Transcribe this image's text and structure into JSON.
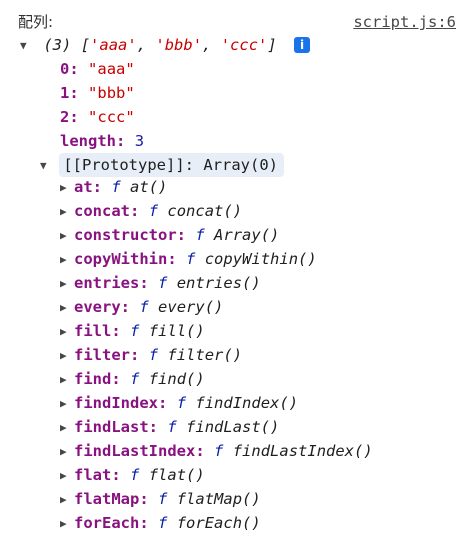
{
  "header": {
    "label": "配列:",
    "source_link": "script.js:6"
  },
  "array": {
    "summary_count": "(3)",
    "summary_open": "[",
    "summary_items": [
      "'aaa'",
      "'bbb'",
      "'ccc'"
    ],
    "summary_close": "]",
    "info_badge": "i",
    "entries": [
      {
        "key": "0",
        "value": "\"aaa\""
      },
      {
        "key": "1",
        "value": "\"bbb\""
      },
      {
        "key": "2",
        "value": "\"ccc\""
      }
    ],
    "length_key": "length",
    "length_value": "3"
  },
  "prototype": {
    "label": "[[Prototype]]",
    "value": "Array(0)",
    "methods": [
      {
        "name": "at",
        "signature": "at()"
      },
      {
        "name": "concat",
        "signature": "concat()"
      },
      {
        "name": "constructor",
        "signature": "Array()"
      },
      {
        "name": "copyWithin",
        "signature": "copyWithin()"
      },
      {
        "name": "entries",
        "signature": "entries()"
      },
      {
        "name": "every",
        "signature": "every()"
      },
      {
        "name": "fill",
        "signature": "fill()"
      },
      {
        "name": "filter",
        "signature": "filter()"
      },
      {
        "name": "find",
        "signature": "find()"
      },
      {
        "name": "findIndex",
        "signature": "findIndex()"
      },
      {
        "name": "findLast",
        "signature": "findLast()"
      },
      {
        "name": "findLastIndex",
        "signature": "findLastIndex()"
      },
      {
        "name": "flat",
        "signature": "flat()"
      },
      {
        "name": "flatMap",
        "signature": "flatMap()"
      },
      {
        "name": "forEach",
        "signature": "forEach()"
      }
    ]
  },
  "glyphs": {
    "expanded": "▼",
    "collapsed": "▶",
    "function_keyword": "f",
    "colon": ":"
  },
  "colors": {
    "string": "#c80000",
    "property_key": "#881280",
    "number": "#1a1aa6",
    "function_keyword": "#0d22aa",
    "info_badge": "#1a73e8",
    "prototype_highlight": "#e8eef7"
  }
}
